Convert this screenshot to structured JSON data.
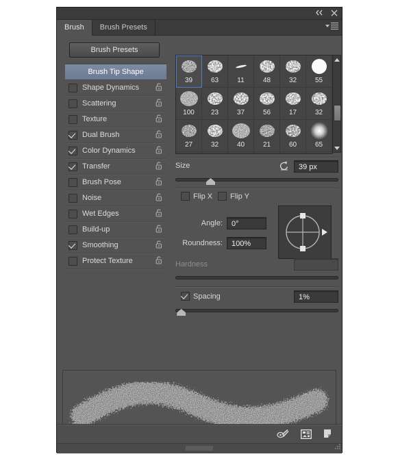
{
  "panel": {
    "titlebar": {
      "collapse_icon": "double-chevron-left-icon",
      "close_icon": "close-icon"
    },
    "tabs": [
      {
        "label": "Brush",
        "active": true
      },
      {
        "label": "Brush Presets",
        "active": false
      }
    ],
    "menu_icon": "panel-menu-icon"
  },
  "left": {
    "presets_button": "Brush Presets",
    "items": [
      {
        "label": "Brush Tip Shape",
        "checked": null,
        "selected": true,
        "lock": false
      },
      {
        "label": "Shape Dynamics",
        "checked": false,
        "selected": false,
        "lock": true
      },
      {
        "label": "Scattering",
        "checked": false,
        "selected": false,
        "lock": true
      },
      {
        "label": "Texture",
        "checked": false,
        "selected": false,
        "lock": true
      },
      {
        "label": "Dual Brush",
        "checked": true,
        "selected": false,
        "lock": true
      },
      {
        "label": "Color Dynamics",
        "checked": true,
        "selected": false,
        "lock": true
      },
      {
        "label": "Transfer",
        "checked": true,
        "selected": false,
        "lock": true
      },
      {
        "label": "Brush Pose",
        "checked": false,
        "selected": false,
        "lock": true
      },
      {
        "label": "Noise",
        "checked": false,
        "selected": false,
        "lock": true
      },
      {
        "label": "Wet Edges",
        "checked": false,
        "selected": false,
        "lock": true
      },
      {
        "label": "Build-up",
        "checked": false,
        "selected": false,
        "lock": true
      },
      {
        "label": "Smoothing",
        "checked": true,
        "selected": false,
        "lock": true
      },
      {
        "label": "Protect Texture",
        "checked": false,
        "selected": false,
        "lock": true
      }
    ]
  },
  "brush_grid": {
    "selected_index": 0,
    "cells": [
      {
        "size": "39",
        "style": "speckle"
      },
      {
        "size": "63",
        "style": "chalk"
      },
      {
        "size": "11",
        "style": "sliver"
      },
      {
        "size": "48",
        "style": "chalk"
      },
      {
        "size": "32",
        "style": "chalk"
      },
      {
        "size": "55",
        "style": "round-hard"
      },
      {
        "size": "100",
        "style": "grain"
      },
      {
        "size": "23",
        "style": "chalk"
      },
      {
        "size": "37",
        "style": "chalk"
      },
      {
        "size": "56",
        "style": "chalk"
      },
      {
        "size": "17",
        "style": "chalk"
      },
      {
        "size": "32",
        "style": "chalk"
      },
      {
        "size": "27",
        "style": "speckle"
      },
      {
        "size": "32",
        "style": "chalk"
      },
      {
        "size": "40",
        "style": "grain"
      },
      {
        "size": "21",
        "style": "speckle"
      },
      {
        "size": "60",
        "style": "scribble"
      },
      {
        "size": "65",
        "style": "round-soft"
      },
      {
        "size": "",
        "style": "speckle"
      },
      {
        "size": "",
        "style": "grain"
      },
      {
        "size": "",
        "style": "chalk"
      },
      {
        "size": "",
        "style": "mesh"
      },
      {
        "size": "",
        "style": "strokes"
      },
      {
        "size": "",
        "style": "round-soft"
      }
    ],
    "scrollbar": {
      "up_icon": "scroll-up-arrow-icon",
      "down_icon": "scroll-down-arrow-icon"
    }
  },
  "controls": {
    "size": {
      "label": "Size",
      "value": "39 px",
      "reset_icon": "reset-size-icon",
      "slider_percent": 20
    },
    "flip_x": {
      "label": "Flip X",
      "checked": false
    },
    "flip_y": {
      "label": "Flip Y",
      "checked": false
    },
    "angle": {
      "label": "Angle:",
      "value": "0°"
    },
    "roundness": {
      "label": "Roundness:",
      "value": "100%"
    },
    "hardness": {
      "label": "Hardness",
      "value": "",
      "disabled": true,
      "slider_percent": 0
    },
    "spacing": {
      "label": "Spacing",
      "checked": true,
      "value": "1%",
      "slider_percent": 1
    },
    "dial": {
      "name": "angle-roundness-dial"
    }
  },
  "footer": {
    "icons": [
      {
        "name": "toggle-brush-pressure-icon"
      },
      {
        "name": "open-preset-manager-icon"
      },
      {
        "name": "create-new-brush-icon"
      }
    ],
    "grip": "panel-resize-grip"
  }
}
